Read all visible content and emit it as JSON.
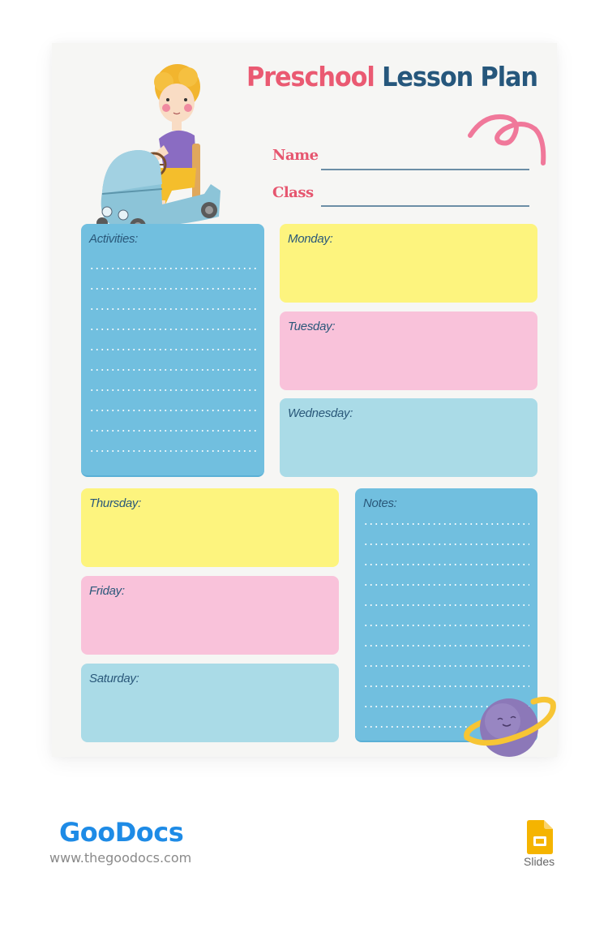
{
  "document": {
    "title_part1": "Preschool",
    "title_part2": "Lesson Plan",
    "colors": {
      "title_pink": "#ea5a72",
      "title_navy": "#26577c",
      "card_blue": "#71bfdf",
      "card_yellow": "#fdf47e",
      "card_pink": "#f9c2da",
      "card_light_blue": "#aadbe7",
      "label_text": "#2a587a"
    },
    "fields": [
      {
        "label": "Name",
        "value": ""
      },
      {
        "label": "Class",
        "value": ""
      }
    ],
    "activities": {
      "label": "Activities:",
      "lines": 10
    },
    "days": [
      {
        "label": "Monday:"
      },
      {
        "label": "Tuesday:"
      },
      {
        "label": "Wednesday:"
      },
      {
        "label": "Thursday:"
      },
      {
        "label": "Friday:"
      },
      {
        "label": "Saturday:"
      }
    ],
    "notes": {
      "label": "Notes:",
      "lines": 11
    },
    "illustrations": [
      "boy-in-car-illustration",
      "pink-ribbon-squiggle",
      "smiling-planet-illustration"
    ]
  },
  "footer": {
    "brand": "GooDocs",
    "url": "www.thegoodocs.com",
    "app_label": "Slides",
    "app_icon": "google-slides-icon"
  }
}
